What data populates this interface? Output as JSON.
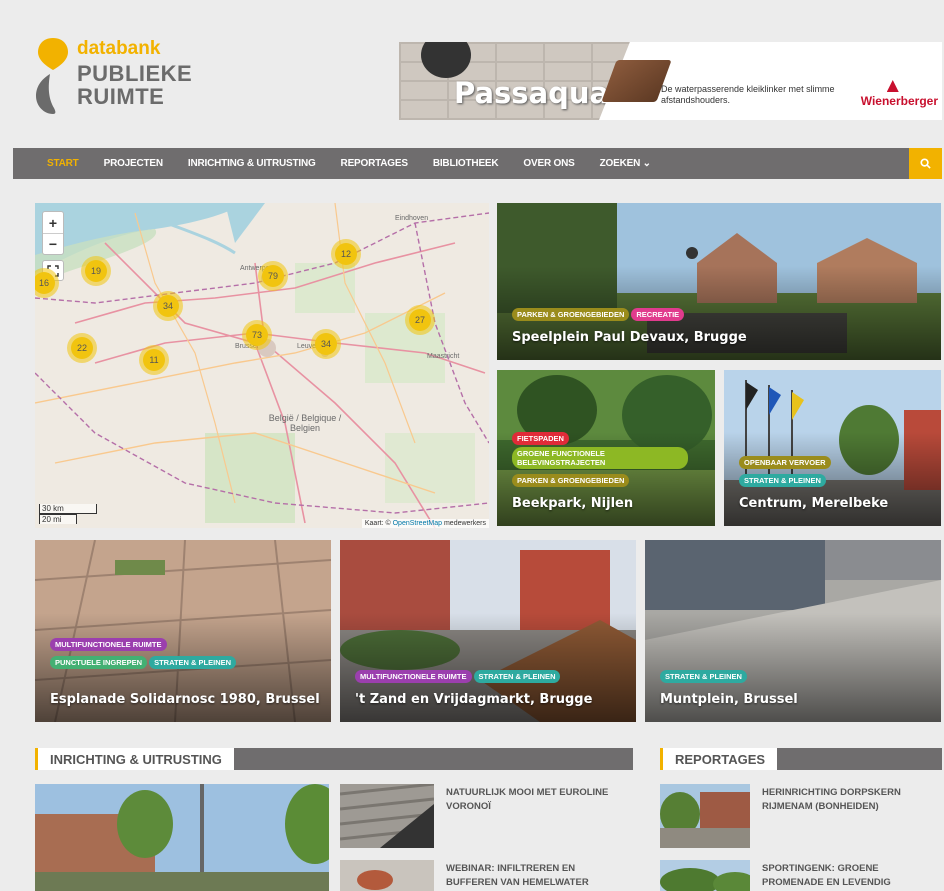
{
  "logo": {
    "small": "databank",
    "line1": "PUBLIEKE",
    "line2": "RUIMTE"
  },
  "banner": {
    "title": "Passaqua",
    "text": "De waterpasserende kleiklinker met slimme afstandshouders.",
    "brand": "Wienerberger"
  },
  "nav": {
    "items": [
      "START",
      "PROJECTEN",
      "INRICHTING & UITRUSTING",
      "REPORTAGES",
      "BIBLIOTHEEK",
      "OVER ONS",
      "ZOEKEN ⌄"
    ],
    "active": 0
  },
  "map": {
    "zoom_in": "+",
    "zoom_out": "−",
    "clusters": [
      "19",
      "16",
      "79",
      "12",
      "34",
      "27",
      "73",
      "34",
      "22",
      "11"
    ],
    "labels": {
      "antwerpen": "Antwerpen",
      "brussel": "Brussel",
      "belgie": "België / Belgique / Belgien",
      "eindhoven": "Eindhoven",
      "maastricht": "Maastricht",
      "leuven": "Leuven"
    },
    "scale_km": "30 km",
    "scale_mi": "20 mi",
    "attribution_prefix": "Kaart: © ",
    "attribution_link": "OpenStreetMap",
    "attribution_suffix": " medewerkers"
  },
  "featured": [
    {
      "title": "Speelplein Paul Devaux, Brugge",
      "tags": [
        "PARKEN & GROENGEBIEDEN",
        "RECREATIE"
      ]
    },
    {
      "title": "Beekpark, Nijlen",
      "tags": [
        "FIETSPADEN",
        "GROENE FUNCTIONELE BELEVINGSTRAJECTEN",
        "PARKEN & GROENGEBIEDEN"
      ]
    },
    {
      "title": "Centrum, Merelbeke",
      "tags": [
        "OPENBAAR VERVOER",
        "STRATEN & PLEINEN"
      ]
    },
    {
      "title": "Esplanade Solidarnosc 1980, Brussel",
      "tags": [
        "MULTIFUNCTIONELE RUIMTE",
        "PUNCTUELE INGREPEN",
        "STRATEN & PLEINEN"
      ]
    },
    {
      "title": "'t Zand en Vrijdagmarkt, Brugge",
      "tags": [
        "MULTIFUNCTIONELE RUIMTE",
        "STRATEN & PLEINEN"
      ]
    },
    {
      "title": "Muntplein, Brussel",
      "tags": [
        "STRATEN & PLEINEN"
      ]
    }
  ],
  "sections": {
    "inrichting": {
      "title": "INRICHTING & UITRUSTING",
      "articles": [
        "NATUURLIJK MOOI MET EUROLINE VORONOÏ",
        "WEBINAR: INFILTREREN EN BUFFEREN VAN HEMELWATER"
      ]
    },
    "reportages": {
      "title": "REPORTAGES",
      "articles": [
        "HERINRICHTING DORPSKERN RIJMENAM (BONHEIDEN)",
        "SPORTINGENK: GROENE PROMENADE EN LEVENDIG"
      ]
    }
  },
  "colors": {
    "accent": "#f2b200",
    "nav": "#6f6d6e",
    "background": "#ececec"
  }
}
